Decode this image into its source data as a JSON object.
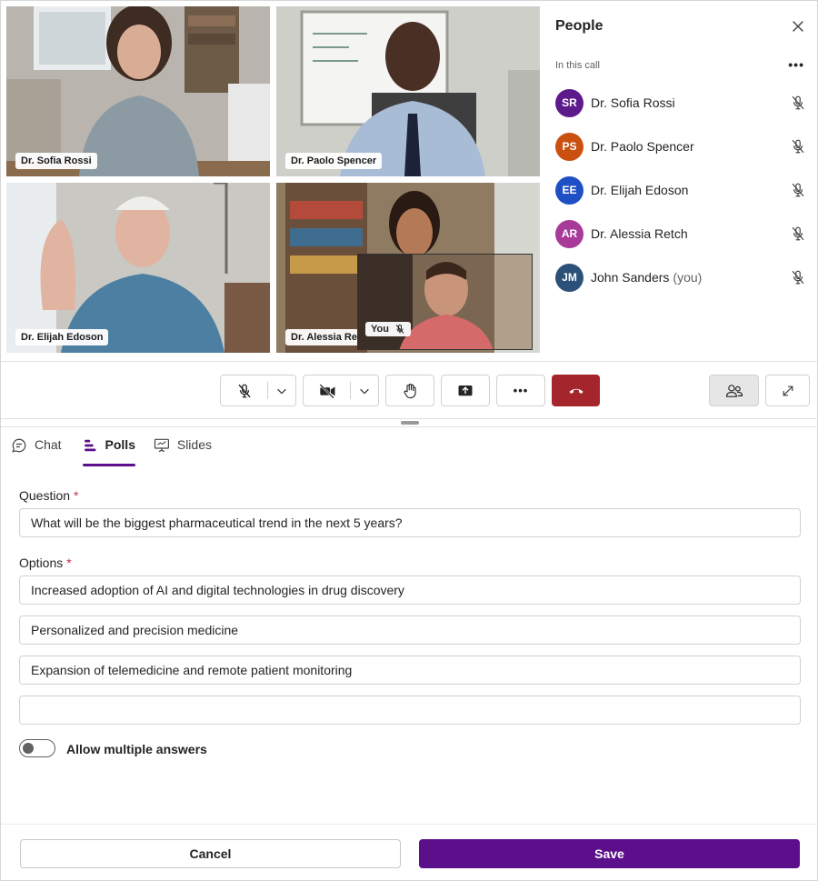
{
  "participants_tiles": [
    {
      "name": "Dr. Sofia Rossi"
    },
    {
      "name": "Dr. Paolo Spencer"
    },
    {
      "name": "Dr. Elijah Edoson"
    },
    {
      "name": "Dr. Alessia Retch"
    }
  ],
  "self_view": {
    "label": "You"
  },
  "people_panel": {
    "title": "People",
    "section_label": "In this call",
    "people": [
      {
        "initials": "SR",
        "name": "Dr. Sofia Rossi",
        "suffix": "",
        "color": "#5c1a8b"
      },
      {
        "initials": "PS",
        "name": "Dr. Paolo Spencer",
        "suffix": "",
        "color": "#ca5010"
      },
      {
        "initials": "EE",
        "name": "Dr. Elijah Edoson",
        "suffix": "",
        "color": "#1f4fc4"
      },
      {
        "initials": "AR",
        "name": "Dr. Alessia Retch",
        "suffix": "",
        "color": "#a83a9a"
      },
      {
        "initials": "JM",
        "name": "John Sanders",
        "suffix": "(you)",
        "color": "#2c5178"
      }
    ]
  },
  "controls": {
    "buttons": [
      "mic-muted-icon",
      "camera-off-icon",
      "raise-hand-icon",
      "share-screen-icon",
      "more-icon",
      "hang-up-icon",
      "people-icon",
      "expand-icon"
    ],
    "leave_color": "#a4262c"
  },
  "tabs": [
    {
      "label": "Chat",
      "icon": "chat-icon",
      "active": false
    },
    {
      "label": "Polls",
      "icon": "polls-icon",
      "active": true
    },
    {
      "label": "Slides",
      "icon": "slides-icon",
      "active": false
    }
  ],
  "poll_form": {
    "question_label": "Question",
    "question_value": "What will be the biggest pharmaceutical trend in the next 5 years?",
    "options_label": "Options",
    "required_mark": "*",
    "options": [
      "Increased adoption of AI and digital technologies in drug discovery",
      "Personalized and precision medicine",
      "Expansion of telemedicine and remote patient monitoring",
      ""
    ],
    "allow_multiple_label": "Allow multiple answers",
    "allow_multiple": false
  },
  "footer": {
    "cancel_label": "Cancel",
    "save_label": "Save"
  },
  "colors": {
    "accent": "#5c0f8b",
    "leave": "#a4262c"
  }
}
